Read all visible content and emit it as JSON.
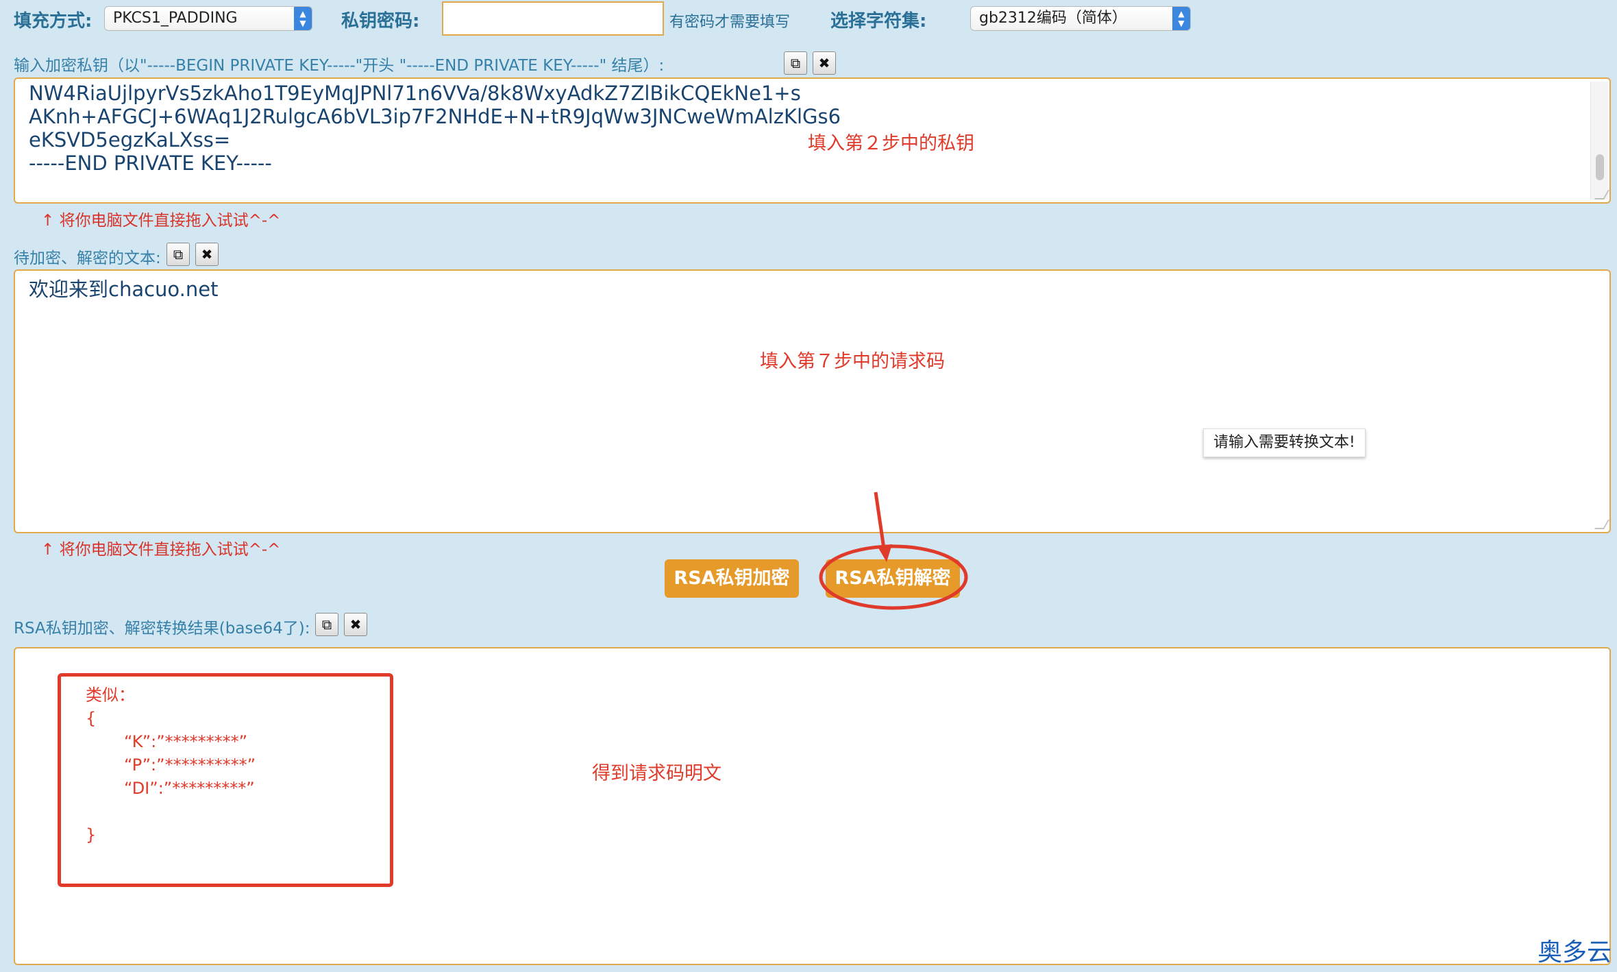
{
  "toolbar": {
    "padding_label": "填充方式:",
    "padding_value": "PKCS1_PADDING",
    "password_label": "私钥密码:",
    "password_value": "",
    "password_hint": "有密码才需要填写",
    "charset_label": "选择字符集:",
    "charset_value": "gb2312编码（简体）"
  },
  "private_key": {
    "label": "输入加密私钥（以\"-----BEGIN PRIVATE KEY-----\"开头 \"-----END PRIVATE KEY-----\" 结尾）:",
    "lines": [
      "NW4RiaUjlpyrVs5zkAho1T9EyMqJPNl71n6VVa/8k8WxyAdkZ7ZlBikCQEkNe1+s",
      "AKnh+AFGCJ+6WAq1J2RulgcA6bVL3ip7F2NHdE+N+tR9JqWw3JNCweWmAlzKlGs6",
      "eKSVD5egzKaLXss=",
      "-----END PRIVATE KEY-----"
    ],
    "annotation": "填入第２步中的私钥",
    "drag_hint": "↑ 将你电脑文件直接拖入试试^-^"
  },
  "plaintext": {
    "label": "待加密、解密的文本:",
    "value": "欢迎来到chacuo.net",
    "annotation": "填入第７步中的请求码",
    "tooltip": "请输入需要转换文本!",
    "drag_hint": "↑ 将你电脑文件直接拖入试试^-^"
  },
  "actions": {
    "encrypt_label": "RSA私钥加密",
    "decrypt_label": "RSA私钥解密"
  },
  "result": {
    "label": "RSA私钥加密、解密转换结果(base64了):",
    "example_lines": [
      "类似：",
      "{",
      "“K”:”*********”",
      "“P”:”**********”",
      "“DI”:”*********”",
      "",
      "}"
    ],
    "annotation": "得到请求码明文"
  },
  "watermark": "奥多云",
  "colors": {
    "background": "#d3e7f3",
    "button": "#e59a2a",
    "annotation_red": "#e03a2a",
    "label_blue": "#2a6f96"
  },
  "icons": {
    "copy": "copy-icon",
    "clear": "close-icon"
  }
}
